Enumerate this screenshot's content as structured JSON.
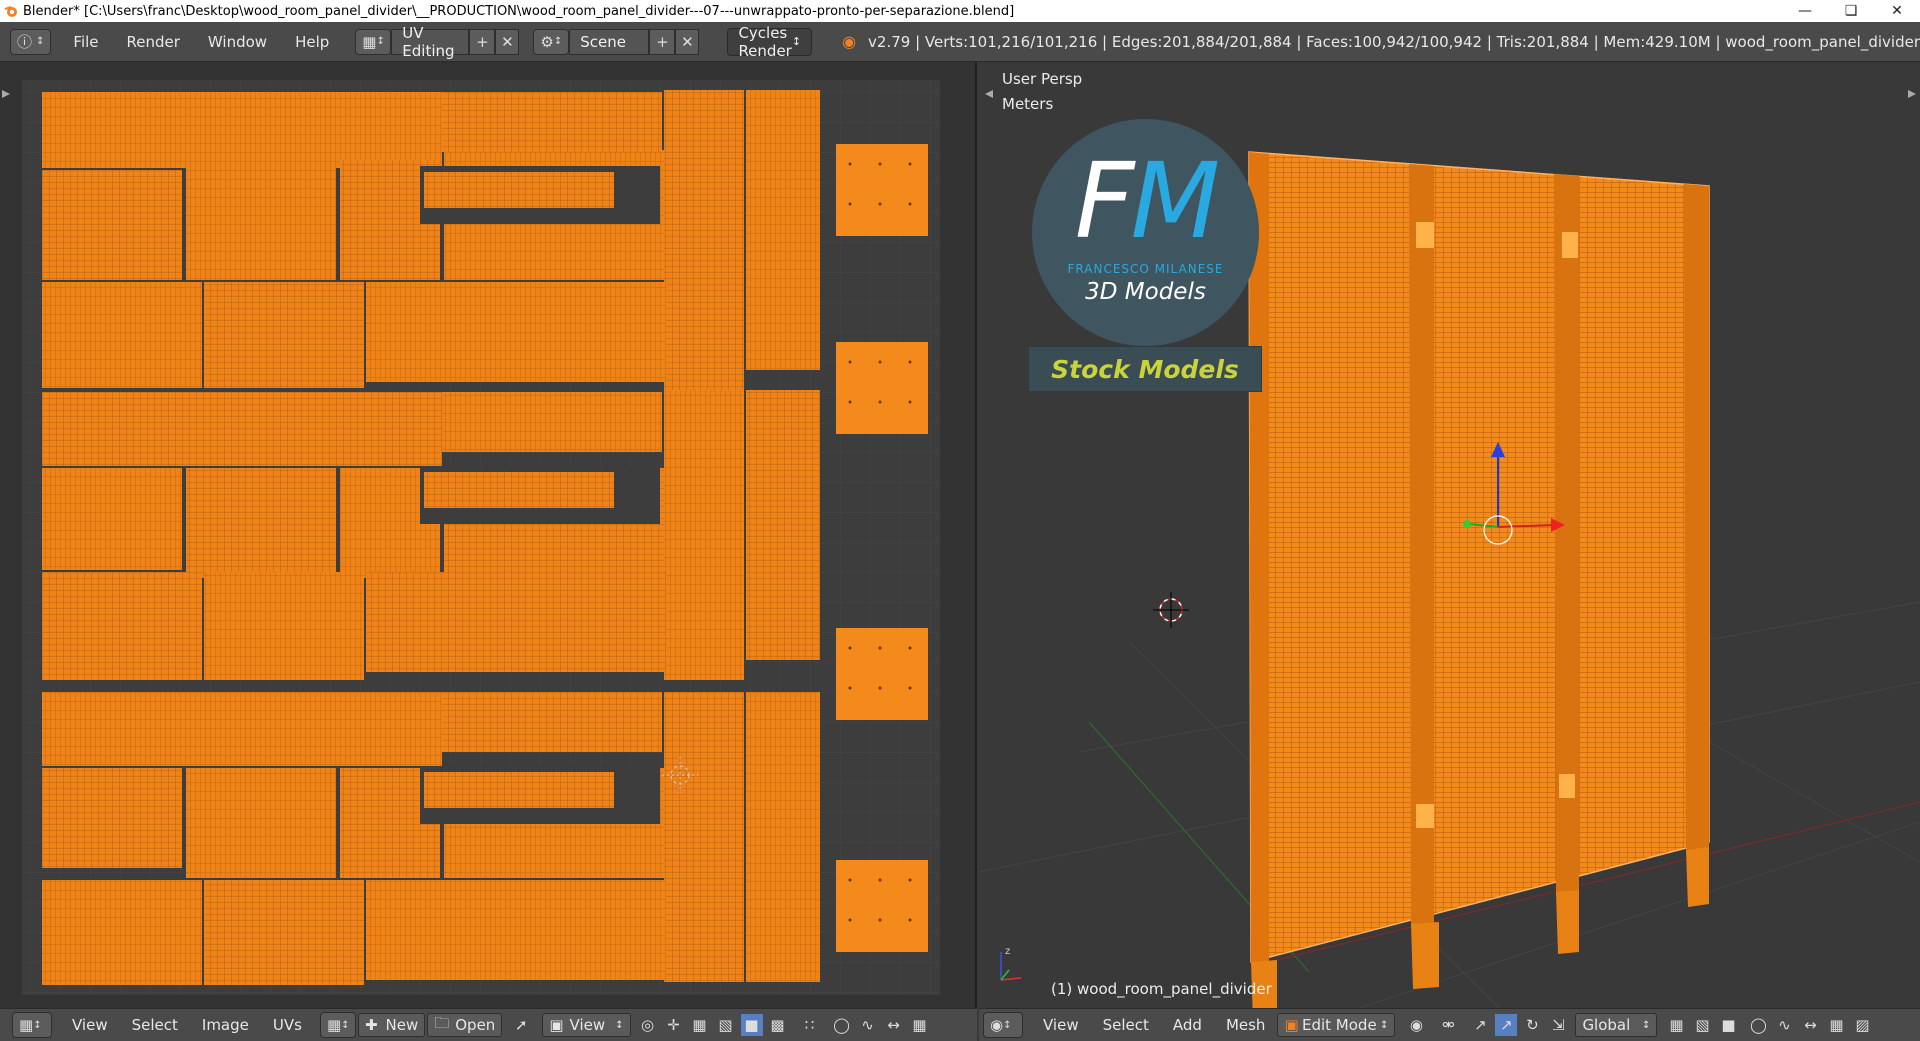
{
  "window": {
    "title": "Blender* [C:\\Users\\franc\\Desktop\\wood_room_panel_divider\\__PRODUCTION\\wood_room_panel_divider---07---unwrappato-pronto-per-separazione.blend]"
  },
  "topbar": {
    "menus": [
      "File",
      "Render",
      "Window",
      "Help"
    ],
    "layout": "UV Editing",
    "scene": "Scene",
    "engine": "Cycles Render",
    "stats": "v2.79 | Verts:101,216/101,216 | Edges:201,884/201,884 | Faces:100,942/100,942 | Tris:201,884 | Mem:429.10M | wood_room_panel_divider"
  },
  "viewport": {
    "persp": "User Persp",
    "units": "Meters",
    "object_label": "(1) wood_room_panel_divider",
    "logo": {
      "initials": "FM",
      "name": "FRANCESCO MILANESE",
      "tagline": "3D Models",
      "banner": "Stock Models"
    }
  },
  "uv_bottombar": {
    "items": [
      "View",
      "Select",
      "Image",
      "UVs"
    ],
    "new_label": "New",
    "open_label": "Open",
    "view_label": "View"
  },
  "view3d_bottombar": {
    "items": [
      "View",
      "Select",
      "Add",
      "Mesh"
    ],
    "mode": "Edit Mode",
    "orientation": "Global"
  },
  "colors": {
    "accent": "#ff8a1a",
    "header": "#4a4a4a",
    "uv_bg": "#3d3d3d"
  }
}
